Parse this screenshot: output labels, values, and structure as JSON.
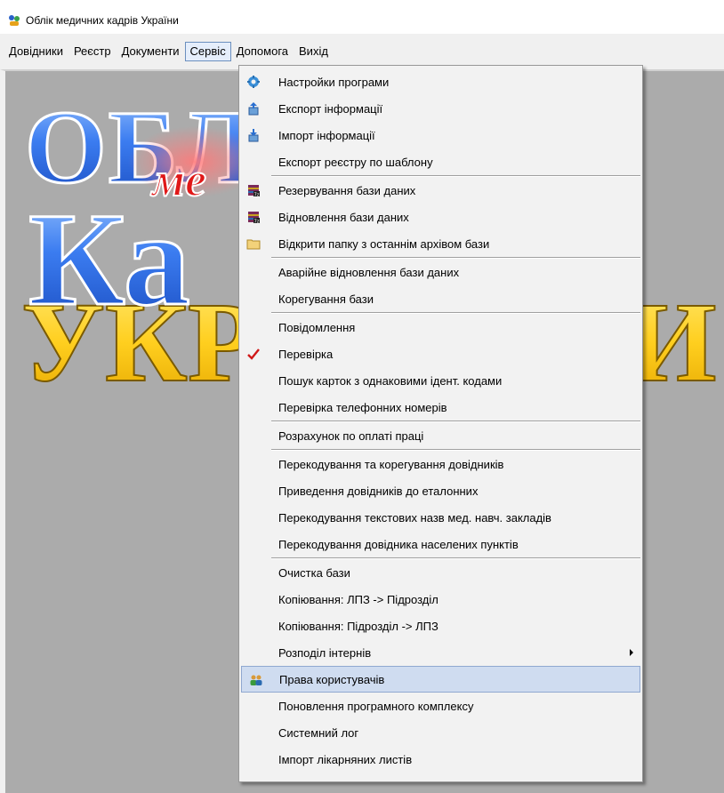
{
  "window": {
    "title": "Облік медичних кадрів України"
  },
  "menubar": {
    "items": [
      "Довідники",
      "Реєстр",
      "Документи",
      "Сервіс",
      "Допомога",
      "Вихід"
    ],
    "active_index": 3
  },
  "logo": {
    "line1": "ОБЛ",
    "line2": "ме",
    "line3": "Ка",
    "line4": "УКР",
    "right_fragment": "И"
  },
  "menu": {
    "groups": [
      [
        {
          "label": "Настройки програми",
          "icon": "gear-icon"
        },
        {
          "label": "Експорт інформації",
          "icon": "export-icon"
        },
        {
          "label": "Імпорт інформації",
          "icon": "import-icon"
        },
        {
          "label": "Експорт реєстру по шаблону",
          "icon": ""
        }
      ],
      [
        {
          "label": "Резервування бази даних",
          "icon": "winrar-icon"
        },
        {
          "label": "Відновлення бази даних",
          "icon": "winrar-icon"
        },
        {
          "label": "Відкрити папку з останнім архівом бази",
          "icon": "folder-icon"
        }
      ],
      [
        {
          "label": "Аварійне відновлення бази даних",
          "icon": ""
        },
        {
          "label": "Корегування бази",
          "icon": ""
        }
      ],
      [
        {
          "label": "Повідомлення",
          "icon": ""
        },
        {
          "label": "Перевірка",
          "icon": "checkmark-icon"
        },
        {
          "label": "Пошук карток з однаковими ідент. кодами",
          "icon": ""
        },
        {
          "label": "Перевірка телефонних номерів",
          "icon": ""
        }
      ],
      [
        {
          "label": "Розрахунок по оплаті праці",
          "icon": ""
        }
      ],
      [
        {
          "label": "Перекодування та корегування довідників",
          "icon": ""
        },
        {
          "label": "Приведення довідників до еталонних",
          "icon": ""
        },
        {
          "label": "Перекодування текстових назв мед. навч. закладів",
          "icon": ""
        },
        {
          "label": "Перекодування довідника населених пунктів",
          "icon": ""
        }
      ],
      [
        {
          "label": "Очистка бази",
          "icon": ""
        },
        {
          "label": "Копіювання: ЛПЗ -> Підрозділ",
          "icon": ""
        },
        {
          "label": "Копіювання: Підрозділ -> ЛПЗ",
          "icon": ""
        },
        {
          "label": "Розподіл інтернів",
          "icon": "",
          "submenu": true
        },
        {
          "label": "Права користувачів",
          "icon": "users-icon",
          "highlighted": true
        },
        {
          "label": "Поновлення програмного комплексу",
          "icon": ""
        },
        {
          "label": "Системний лог",
          "icon": ""
        },
        {
          "label": "Імпорт лікарняних листів",
          "icon": ""
        }
      ]
    ]
  }
}
